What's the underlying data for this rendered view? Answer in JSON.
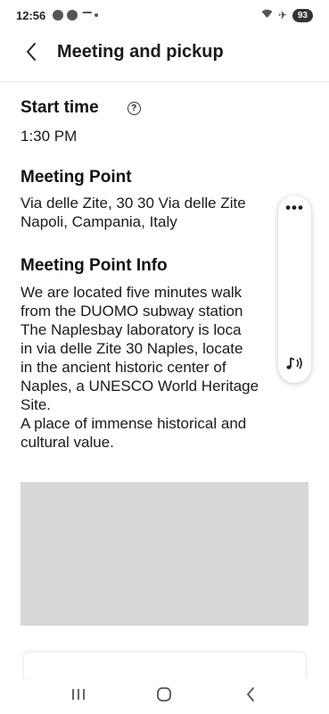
{
  "status_bar": {
    "time": "12:56",
    "battery": "93",
    "icons": [
      "notification-icon",
      "wifi-icon",
      "airplane-icon"
    ]
  },
  "header": {
    "title": "Meeting and pickup",
    "back_icon": "chevron-left-icon"
  },
  "start_time": {
    "label": "Start time",
    "help_glyph": "?",
    "value": "1:30 PM"
  },
  "meeting_point": {
    "label": "Meeting Point",
    "value": "Via delle Zite, 30 30 Via delle Zite\nNapoli, Campania, Italy"
  },
  "meeting_point_info": {
    "label": "Meeting Point Info",
    "value": "We are located five minutes walk\nfrom the DUOMO subway station\nThe Naplesbay laboratory is loca\nin via delle Zite 30 Naples, locate\nin the ancient historic center of\nNaples, a UNESCO World Heritage\nSite.\nA place of immense historical and\ncultural value."
  },
  "side_panel": {
    "more_glyph": "•••",
    "icons": [
      "more-icon",
      "sound-icon"
    ]
  },
  "nav_bar": {
    "icons": [
      "recent-apps-icon",
      "home-icon",
      "back-icon"
    ]
  }
}
